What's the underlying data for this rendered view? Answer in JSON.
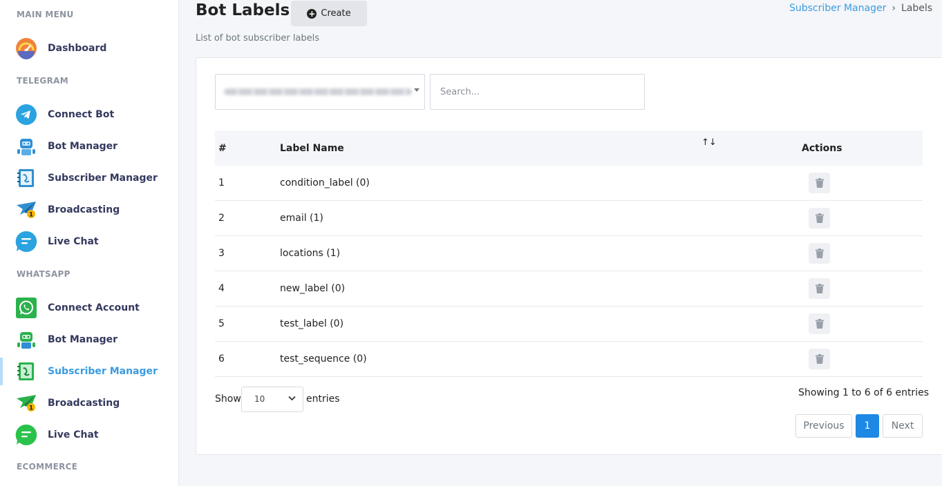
{
  "sidebar": {
    "sections": {
      "main_menu": "MAIN MENU",
      "telegram": "TELEGRAM",
      "whatsapp": "WHATSAPP",
      "ecommerce": "ECOMMERCE"
    },
    "items": [
      {
        "label": "Dashboard",
        "icon": "speedometer-icon"
      },
      {
        "label": "Connect Bot",
        "icon": "telegram-icon"
      },
      {
        "label": "Bot Manager",
        "icon": "robot-icon"
      },
      {
        "label": "Subscriber Manager",
        "icon": "contacts-book-icon"
      },
      {
        "label": "Broadcasting",
        "icon": "paper-plane-icon"
      },
      {
        "label": "Live Chat",
        "icon": "chat-bubble-icon"
      },
      {
        "label": "Connect Account",
        "icon": "whatsapp-icon"
      },
      {
        "label": "Bot Manager",
        "icon": "robot-icon"
      },
      {
        "label": "Subscriber Manager",
        "icon": "contacts-book-icon",
        "active": true
      },
      {
        "label": "Broadcasting",
        "icon": "paper-plane-icon"
      },
      {
        "label": "Live Chat",
        "icon": "chat-bubble-icon"
      }
    ]
  },
  "header": {
    "title": "Bot Labels",
    "create_label": "Create",
    "subtitle": "List of bot subscriber labels",
    "breadcrumb": {
      "parent": "Subscriber Manager",
      "separator": "›",
      "current": "Labels"
    }
  },
  "filters": {
    "bot_select_value": "mehedi_test_display_name (+8801...)",
    "search_placeholder": "Search..."
  },
  "table": {
    "columns": [
      "#",
      "Label Name",
      "Actions"
    ],
    "rows": [
      {
        "num": "1",
        "name": "condition_label (0)"
      },
      {
        "num": "2",
        "name": "email (1)"
      },
      {
        "num": "3",
        "name": "locations (1)"
      },
      {
        "num": "4",
        "name": "new_label (0)"
      },
      {
        "num": "5",
        "name": "test_label (0)"
      },
      {
        "num": "6",
        "name": "test_sequence (0)"
      }
    ]
  },
  "footer": {
    "show_label": "Show",
    "page_length": "10",
    "entries_label": "entries",
    "info": "Showing 1 to 6 of 6 entries",
    "prev": "Previous",
    "current_page": "1",
    "next": "Next"
  },
  "colors": {
    "accent": "#3b9be0",
    "pager_active": "#1e88e5"
  }
}
